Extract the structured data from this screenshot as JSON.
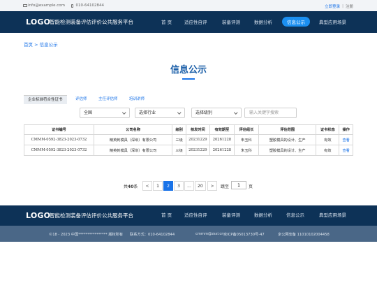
{
  "topbar": {
    "email": "info@example.com",
    "phone": "010-64102844",
    "login": "立即登录",
    "separator": "|",
    "register": "注册"
  },
  "header": {
    "logo": "LOGO",
    "title": "智能检测装备评估评价公共服务平台",
    "nav": [
      "首 页",
      "适应性自评",
      "装备评测",
      "数据分析",
      "信息公示",
      "典型应用场景"
    ],
    "active_nav": "信息公示"
  },
  "breadcrumb": {
    "home": "首页",
    "sep": ">",
    "current": "信息公示"
  },
  "page_title": "信息公示",
  "tabs": [
    "企业标准符合性证书",
    "评估师",
    "主任评估师",
    "培训讲师"
  ],
  "filters": {
    "region": "全国",
    "industry": "选择行业",
    "level": "选择级别",
    "search_placeholder": "输入关键字搜索"
  },
  "table": {
    "headers": [
      "证书编号",
      "公司名称",
      "级别",
      "核发时间",
      "有效期至",
      "评估组长",
      "评估范围",
      "证书状态",
      "操作"
    ],
    "rows": [
      [
        "CMMM-0592-3823-2023-0732",
        "精英刺模具（深圳）有限公司",
        "三级",
        "20231229",
        "20261228",
        "朱玉科",
        "塑胶模具的设计、生产",
        "有效",
        "查看"
      ],
      [
        "CMMM-0592-3823-2023-0732",
        "精英刺模具（深圳）有限公司",
        "三级",
        "20231229",
        "20261228",
        "朱玉科",
        "塑胶模具的设计、生产",
        "有效",
        "查看"
      ]
    ]
  },
  "pagination": {
    "total_prefix": "共",
    "total": "40",
    "total_suffix": "条",
    "prev": "<",
    "pages": [
      "1",
      "2",
      "3",
      "...",
      "20"
    ],
    "current": "2",
    "next": ">",
    "goto_prefix": "跳至",
    "goto_value": "1",
    "goto_suffix": "页"
  },
  "footer": {
    "logo": "LOGO",
    "title": "智能检测装备评估评价公共服务平台",
    "nav": [
      "首 页",
      "适应性自评",
      "装备评测",
      "数据分析",
      "信息公示",
      "典型应用场景"
    ],
    "copyright": "©18 - 2023 中国**************** 版权所有",
    "contact": "联系方式：010-64102844",
    "email": "cmmm@zssi.cn",
    "icp": "京ICP备05013730号-47",
    "police": "京公网安备 11010102004458"
  },
  "colors": {
    "header_bg": "#0d3257",
    "accent": "#1a73e8",
    "footer_bottom_bg": "#4a6787"
  }
}
